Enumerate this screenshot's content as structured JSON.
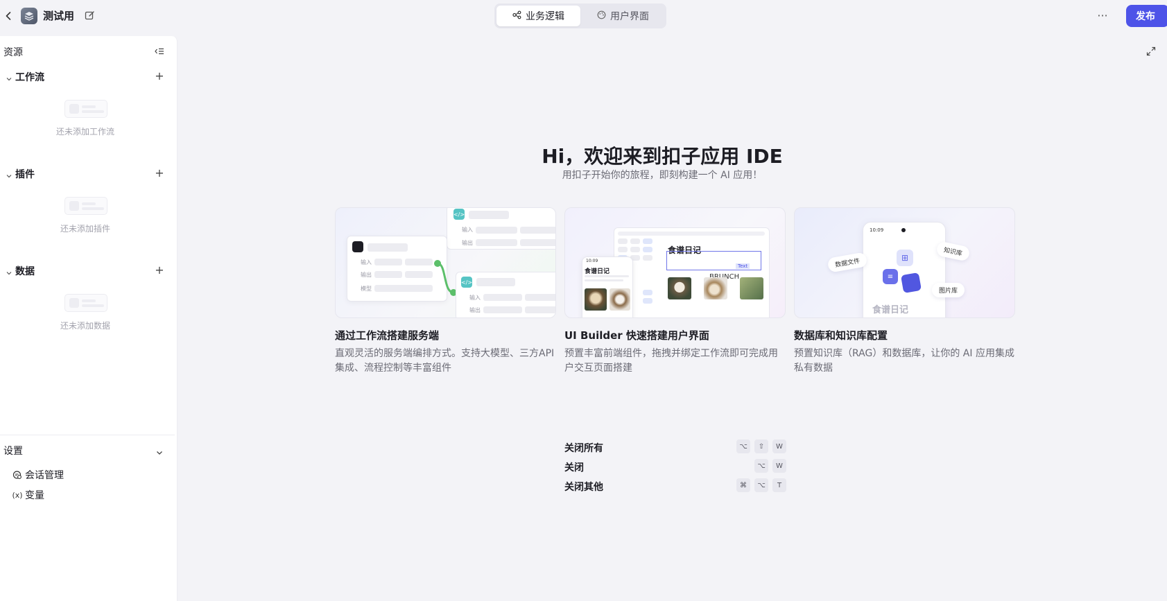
{
  "app": {
    "name": "测试用"
  },
  "mode_tabs": [
    {
      "label": "业务逻辑",
      "icon": "flow-icon",
      "active": true
    },
    {
      "label": "用户界面",
      "icon": "palette-icon",
      "active": false
    }
  ],
  "header": {
    "more_label": "···",
    "publish_label": "发布"
  },
  "sidebar": {
    "title": "资源",
    "sections": [
      {
        "title": "工作流",
        "empty_text": "还未添加工作流"
      },
      {
        "title": "插件",
        "empty_text": "还未添加插件"
      },
      {
        "title": "数据",
        "empty_text": "还未添加数据"
      }
    ],
    "settings": {
      "title": "设置",
      "items": [
        {
          "label": "会话管理",
          "icon": "chat-manage-icon"
        },
        {
          "label": "变量",
          "icon": "variable-icon",
          "glyph": "(x)"
        }
      ]
    }
  },
  "welcome": {
    "title": "Hi，欢迎来到扣子应用 IDE",
    "subtitle": "用扣子开始你的旅程，即刻构建一个 AI 应用！"
  },
  "cards": [
    {
      "title": "通过工作流搭建服务端",
      "desc": "直观灵活的服务端编排方式。支持大模型、三方API集成、流程控制等丰富组件",
      "illus": {
        "input": "输入",
        "output": "输出",
        "model": "模型"
      }
    },
    {
      "title": "UI Builder 快速搭建用户界面",
      "desc": "预置丰富前端组件，拖拽并绑定工作流即可完成用户交互页面搭建",
      "illus": {
        "phone_time": "10:09",
        "recipe": "食谱日记",
        "recipe2": "食谱日记",
        "text_tag": "Text",
        "brunch": "BRUNCH"
      }
    },
    {
      "title": "数据库和知识库配置",
      "desc": "预置知识库（RAG）和数据库，让你的 AI 应用集成私有数据",
      "illus": {
        "phone_time": "10:09",
        "data_file": "数据文件",
        "knowledge": "知识库",
        "image_lib": "图片库",
        "recipe": "食谱日记"
      }
    }
  ],
  "shortcuts": [
    {
      "label": "关闭所有",
      "keys": [
        "⌥",
        "⇧",
        "W"
      ]
    },
    {
      "label": "关闭",
      "keys": [
        "⌥",
        "W"
      ]
    },
    {
      "label": "关闭其他",
      "keys": [
        "⌘",
        "⌥",
        "T"
      ]
    }
  ],
  "colors": {
    "accent": "#4d53e8",
    "background": "#f3f3f7",
    "panel": "#ffffff"
  }
}
